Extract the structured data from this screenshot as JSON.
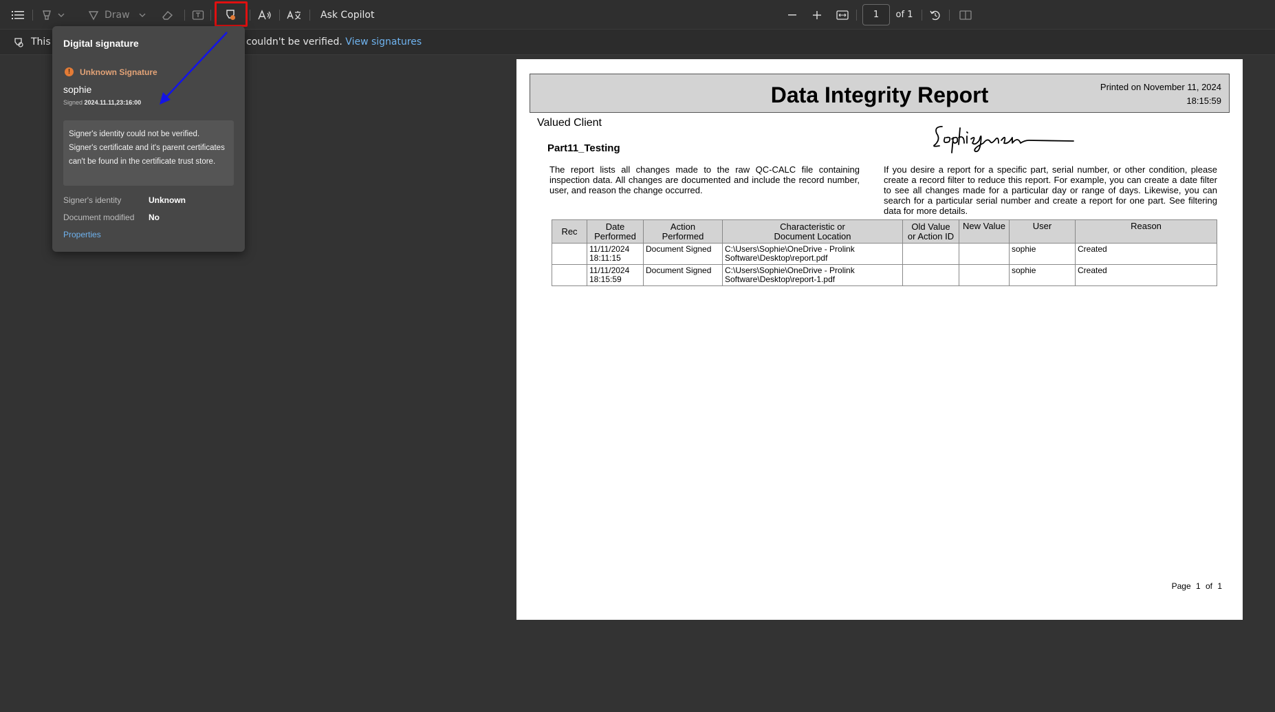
{
  "toolbar": {
    "draw_label": "Draw",
    "ask_copilot_label": "Ask Copilot",
    "page_number": "1",
    "page_of": "of 1"
  },
  "infobar": {
    "message_start": "This d",
    "message_end": "couldn't be verified.",
    "view_signatures_link": "View signatures"
  },
  "popup": {
    "title": "Digital signature",
    "status": "Unknown Signature",
    "signer": "sophie",
    "signed_prefix": "Signed",
    "signed_date": "2024.11.11,23:16:00",
    "note": "Signer's identity could not be verified. Signer's certificate and it's parent certificates can't be found in the certificate trust store.",
    "identity_label": "Signer's identity",
    "identity_value": "Unknown",
    "modified_label": "Document modified",
    "modified_value": "No",
    "properties_link": "Properties"
  },
  "document": {
    "title": "Data Integrity Report",
    "printed_on": "Printed on November 11, 2024",
    "printed_time": "18:15:59",
    "client": "Valued Client",
    "part": "Part11_Testing",
    "para_left": "The report lists all changes made to the raw QC-CALC file containing inspection data. All changes are documented and include the record number, user, and reason the change occurred.",
    "para_right": "If you desire a report for a specific part, serial number, or other condition, please create a record filter to reduce this report. For example, you can create a date filter to see all changes made for a particular day or range of days. Likewise, you can search for a particular serial number and create a report for one part. See filtering data for more details.",
    "table": {
      "headers": {
        "rec": "Rec",
        "date1": "Date",
        "date2": "Performed",
        "action1": "Action",
        "action2": "Performed",
        "char1": "Characteristic or",
        "char2": "Document Location",
        "old1": "Old Value",
        "old2": "or Action ID",
        "new_value": "New Value",
        "user": "User",
        "reason": "Reason"
      },
      "rows": [
        {
          "rec": "",
          "date1": "11/11/2024",
          "date2": "18:11:15",
          "action": "Document Signed",
          "loc1": "C:\\Users\\Sophie\\OneDrive - Prolink",
          "loc2": "Software\\Desktop\\report.pdf",
          "old": "",
          "new": "",
          "user": "sophie",
          "reason": "Created"
        },
        {
          "rec": "",
          "date1": "11/11/2024",
          "date2": "18:15:59",
          "action": "Document Signed",
          "loc1": "C:\\Users\\Sophie\\OneDrive - Prolink",
          "loc2": "Software\\Desktop\\report-1.pdf",
          "old": "",
          "new": "",
          "user": "sophie",
          "reason": "Created"
        }
      ]
    },
    "page_footer": "Page 1 of 1"
  },
  "colors": {
    "highlight": "#e01010",
    "arrow": "#1414e6",
    "link": "#6fb3ef",
    "warning": "#e37b36"
  }
}
